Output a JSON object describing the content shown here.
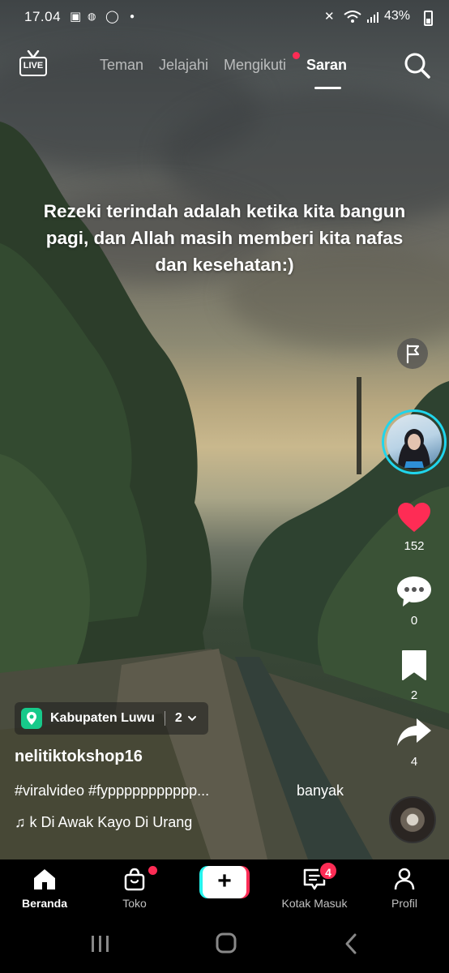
{
  "status_bar": {
    "time": "17.04",
    "battery": "43%",
    "icons": [
      "gallery-icon",
      "line-icon",
      "whatsapp-icon",
      "dot-icon",
      "mute-icon",
      "wifi-icon",
      "signal-icon",
      "battery-icon"
    ]
  },
  "top_nav": {
    "live_label": "LIVE",
    "tabs": [
      {
        "label": "Teman"
      },
      {
        "label": "Jelajahi"
      },
      {
        "label": "Mengikuti"
      },
      {
        "label": "Saran"
      }
    ],
    "active_tab": "Saran"
  },
  "video": {
    "caption_overlay": "Rezeki terindah adalah ketika kita bangun pagi, dan Allah masih memberi kita nafas dan kesehatan:)"
  },
  "actions": {
    "likes": "152",
    "comments": "0",
    "saves": "2",
    "shares": "4"
  },
  "post": {
    "location": "Kabupaten Luwu",
    "location_count": "2",
    "username": "nelitiktokshop16",
    "caption": "#viralvideo #fyppppppppppp...",
    "more_label": "banyak",
    "music": "k Di Awak Kayo Di Urang"
  },
  "tabbar": {
    "items": [
      {
        "label": "Beranda"
      },
      {
        "label": "Toko"
      },
      {
        "label": ""
      },
      {
        "label": "Kotak Masuk"
      },
      {
        "label": "Profil"
      }
    ],
    "inbox_badge": "4"
  },
  "colors": {
    "accent_red": "#fe2c55",
    "accent_cyan": "#25f4ee",
    "avatar_ring": "#20d5ec",
    "location_green": "#17c98a"
  }
}
